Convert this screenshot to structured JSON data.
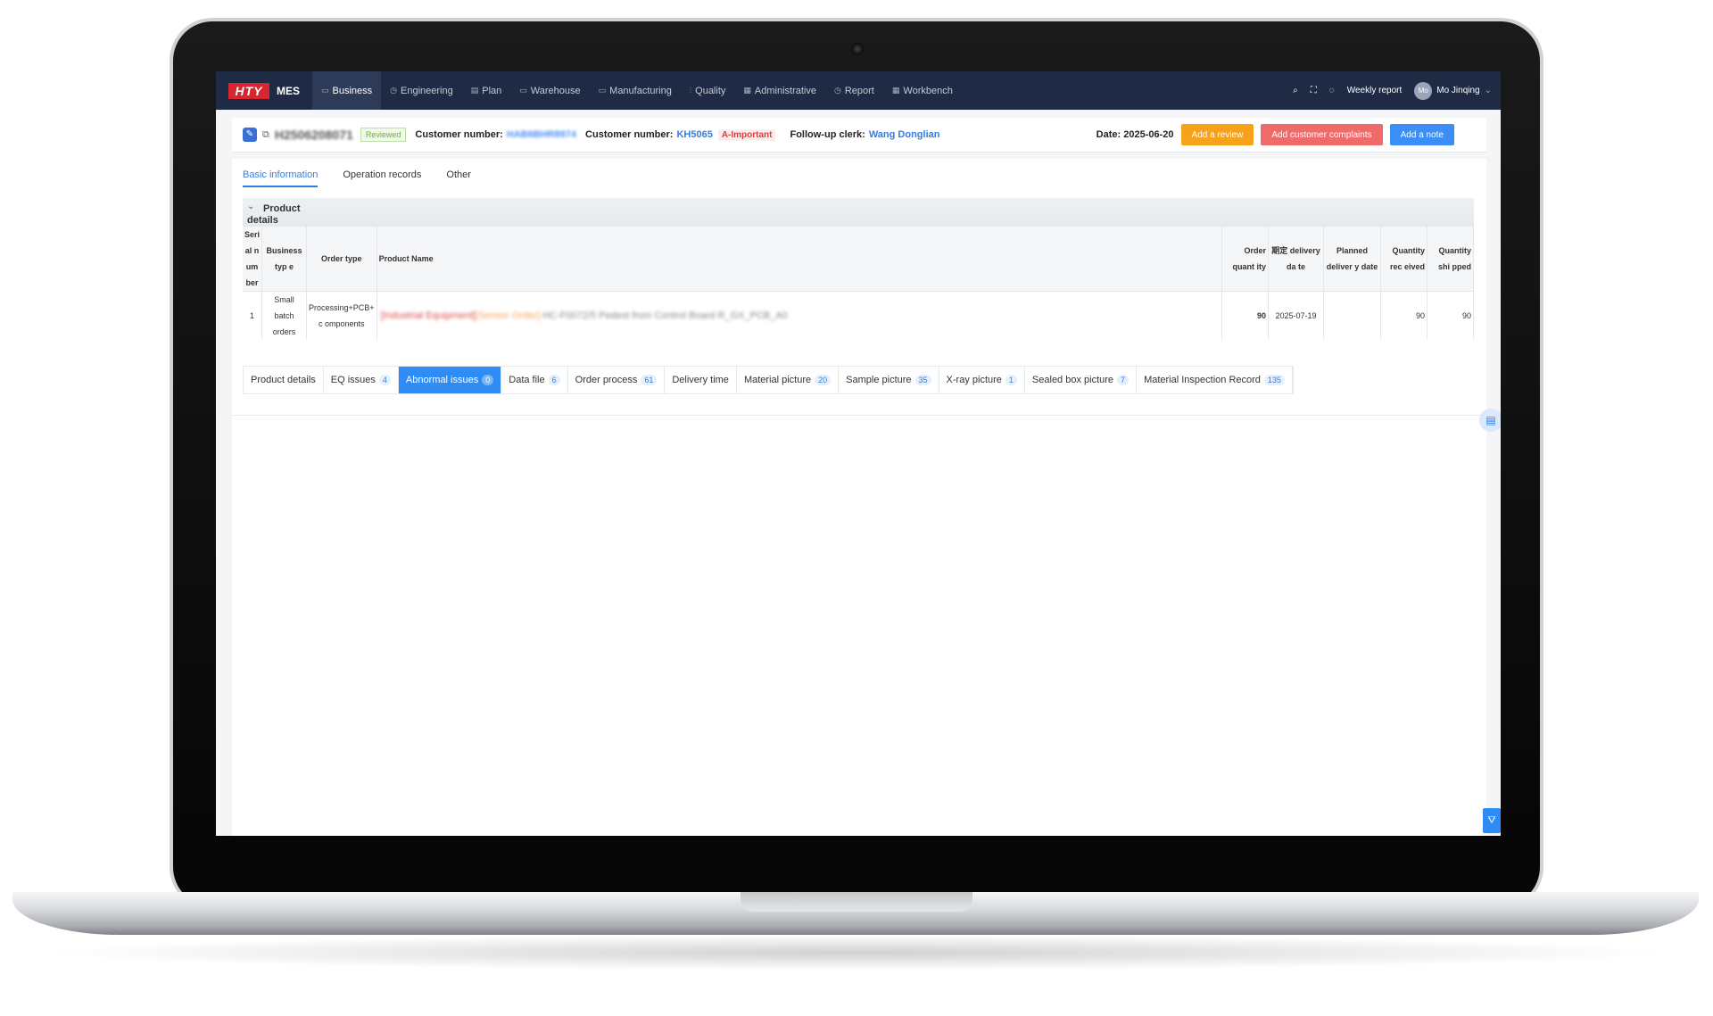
{
  "app": {
    "logo_mark": "HTY",
    "name": "MES"
  },
  "nav": {
    "items": [
      {
        "label": "Business",
        "icon": "folder-icon"
      },
      {
        "label": "Engineering",
        "icon": "clock-icon"
      },
      {
        "label": "Plan",
        "icon": "doc-icon"
      },
      {
        "label": "Warehouse",
        "icon": "box-icon"
      },
      {
        "label": "Manufacturing",
        "icon": "box-icon"
      },
      {
        "label": "Quality",
        "icon": "chart-icon"
      },
      {
        "label": "Administrative",
        "icon": "grid-icon"
      },
      {
        "label": "Report",
        "icon": "clock-icon"
      },
      {
        "label": "Workbench",
        "icon": "grid-icon"
      }
    ],
    "weekly_report": "Weekly report",
    "user_initials": "Mo",
    "user_name": "Mo Jinqing"
  },
  "header": {
    "order_no": "H2506208071",
    "status": "Reviewed",
    "customer_number_label": "Customer number:",
    "customer_number_value_blurred": "HAB6BHR8974",
    "customer_number_label2": "Customer number:",
    "customer_number_value": "KH5065",
    "priority": "A-Important",
    "followup_label": "Follow-up clerk:",
    "followup_value": "Wang Donglian",
    "date_label": "Date:",
    "date_value": "2025-06-20",
    "buttons": {
      "add_review": "Add a review",
      "add_complaints": "Add customer complaints",
      "add_note": "Add a note"
    }
  },
  "tabs": [
    "Basic information",
    "Operation records",
    "Other"
  ],
  "section": {
    "title": "Product details"
  },
  "table": {
    "headers": {
      "serial": "Seri al n um ber",
      "business_type": "Business typ e",
      "order_type": "Order type",
      "product_name": "Product Name",
      "order_qty": "Order quant ity",
      "delivery_date": "期定 delivery da te",
      "planned_delivery": "Planned deliver y date",
      "qty_received": "Quantity rec eived",
      "qty_shipped": "Quantity shi pped"
    },
    "rows": [
      {
        "serial": "1",
        "business_type": "Small batch orders",
        "order_type": "Processing+PCB+ c omponents",
        "product_name_part1": "[Industrial Equipment]",
        "product_name_part2": "[Sensor Order]",
        "product_name_part3": "HC-F0072/5 Pedest from Control Board R_GX_PCB_A0",
        "order_qty": "90",
        "delivery_date": "2025-07-19",
        "planned_delivery": "",
        "qty_received": "90",
        "qty_shipped": "90"
      }
    ]
  },
  "subtabs": [
    {
      "label": "Product details",
      "count": ""
    },
    {
      "label": "EQ issues",
      "count": "4"
    },
    {
      "label": "Abnormal issues",
      "count": "0"
    },
    {
      "label": "Data file",
      "count": "6"
    },
    {
      "label": "Order process",
      "count": "61"
    },
    {
      "label": "Delivery time",
      "count": ""
    },
    {
      "label": "Material picture",
      "count": "20"
    },
    {
      "label": "Sample picture",
      "count": "35"
    },
    {
      "label": "X-ray picture",
      "count": "1"
    },
    {
      "label": "Sealed box picture",
      "count": "7"
    },
    {
      "label": "Material Inspection Record",
      "count": "135"
    }
  ],
  "colors": {
    "topbar": "#1f2a44",
    "accent": "#2f8cf5",
    "orange": "#f7a21b",
    "red": "#f06a6a"
  }
}
